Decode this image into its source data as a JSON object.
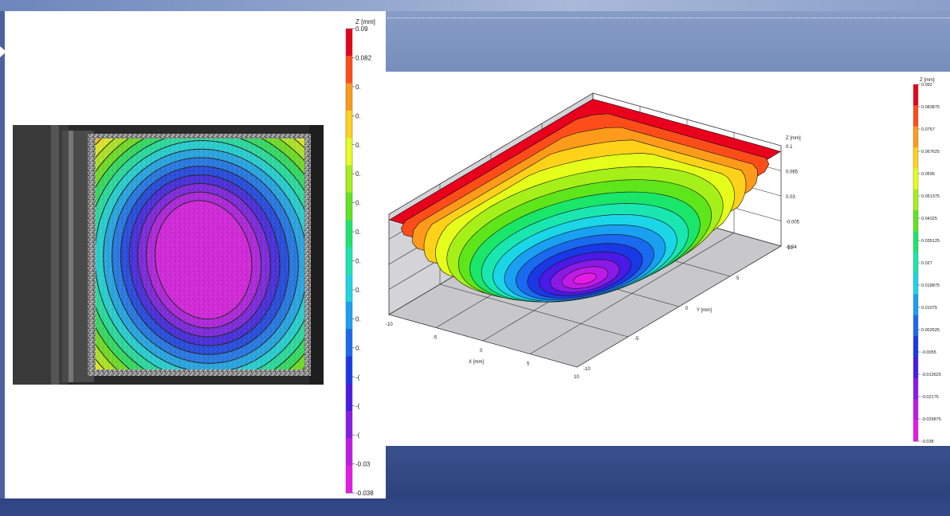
{
  "slide": {
    "left_figure": {
      "caption": ""
    },
    "right_figure": {
      "caption": ""
    }
  },
  "chart_data": [
    {
      "type": "heatmap",
      "colorbar_title": "Z [mm]",
      "colorbar_ticks": [
        "0.09",
        "0.082",
        "0.",
        "0.",
        "0.",
        "0.",
        "0.",
        "0.",
        "0.",
        "0.",
        "0.",
        "0.",
        "-(",
        "-(",
        "-(",
        "-0.03",
        "-0.038"
      ],
      "zlim": [
        -0.038,
        0.09
      ],
      "colors": [
        "#e8001c",
        "#ff4d1a",
        "#ff9a1a",
        "#ffd21a",
        "#e6ff1a",
        "#a6f01a",
        "#5ee61a",
        "#1ae66a",
        "#1ae6b0",
        "#1ad6e6",
        "#1aa0f0",
        "#1a6af0",
        "#1a38e6",
        "#4a1ae6",
        "#8a1ae6",
        "#c01ae6",
        "#e61ae6"
      ]
    },
    {
      "type": "surface",
      "colorbar_title": "Z [mm]",
      "colorbar_ticks": [
        "0.092",
        "0.083875",
        "0.0757",
        "0.067625",
        "0.0595",
        "0.051375",
        "0.04325",
        "0.035125",
        "0.027",
        "0.018875",
        "0.01075",
        "0.002625",
        "-0.0055",
        "-0.013625",
        "-0.02175",
        "-0.029875",
        "-0.038"
      ],
      "zlim": [
        -0.038,
        0.092
      ],
      "z_axis_label": "Z [mm]",
      "z_ticks": [
        "0.1",
        "0.065",
        "0.03",
        "-0.005",
        "-0.04"
      ],
      "x_axis_label": "X [mm]",
      "x_ticks": [
        "-10",
        "-5",
        "0",
        "5",
        "10"
      ],
      "y_axis_label": "Y [mm]",
      "y_ticks": [
        "10",
        "5",
        "0",
        "-5",
        "-10"
      ],
      "colors": [
        "#e8001c",
        "#ff4d1a",
        "#ff9a1a",
        "#ffd21a",
        "#e6ff1a",
        "#a6f01a",
        "#5ee61a",
        "#1ae66a",
        "#1ae6b0",
        "#1ad6e6",
        "#1aa0f0",
        "#1a6af0",
        "#1a38e6",
        "#4a1ae6",
        "#8a1ae6",
        "#c01ae6",
        "#e61ae6"
      ]
    }
  ]
}
